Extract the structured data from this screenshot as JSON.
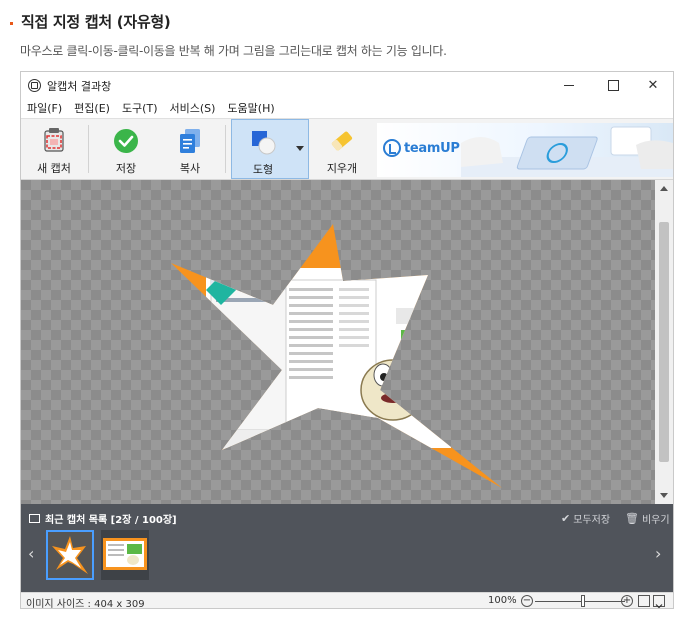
{
  "heading": {
    "title": "직접 지정 캡처 (자유형)",
    "description": "마우스로 클릭-이동-클릭-이동을 반복 해 가며 그림을 그리는대로 캡처 하는 기능 입니다."
  },
  "window": {
    "title": "알캡처 결과창"
  },
  "menu": [
    {
      "label": "파일(F)"
    },
    {
      "label": "편집(E)"
    },
    {
      "label": "도구(T)"
    },
    {
      "label": "서비스(S)"
    },
    {
      "label": "도움말(H)"
    }
  ],
  "toolbar": {
    "new_capture": "새 캡처",
    "save": "저장",
    "copy": "복사",
    "shape": "도형",
    "eraser": "지우개"
  },
  "ad": {
    "brand": "teamUP"
  },
  "recent": {
    "title": "최근 캡처 목록 [2장 / 100장]",
    "save_all": "모두저장",
    "clear_all": "비우기"
  },
  "status": {
    "image_size": "이미지 사이즈 : 404 x 309",
    "zoom": "100%",
    "zoom_level": 0.55
  },
  "colors": {
    "accent": "#e8591a",
    "selection": "#4a9eff",
    "star_orange": "#f7931e"
  },
  "icons": {
    "new_capture": "camera-icon",
    "save": "check-icon",
    "copy": "copy-icon",
    "shape": "shape-icon",
    "eraser": "eraser-icon"
  }
}
